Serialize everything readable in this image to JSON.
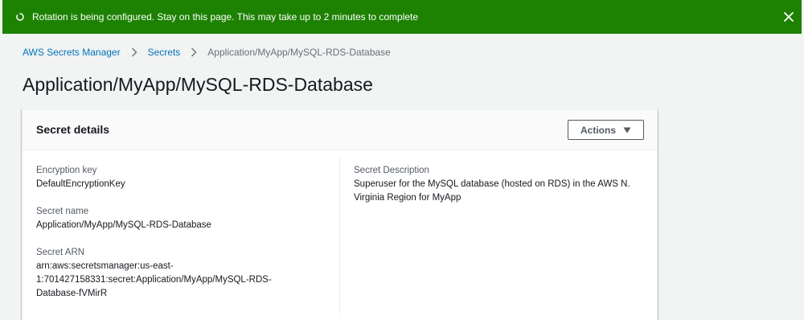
{
  "flash": {
    "message": "Rotation is being configured. Stay on this page. This may take up to 2 minutes to complete",
    "status": "in-progress",
    "color": "#1d8102",
    "icons": {
      "status": "spinner-icon",
      "dismiss": "close-icon"
    }
  },
  "breadcrumb": [
    {
      "label": "AWS Secrets Manager"
    },
    {
      "label": "Secrets"
    },
    {
      "label": "Application/MyApp/MySQL-RDS-Database"
    }
  ],
  "page_title": "Application/MyApp/MySQL-RDS-Database",
  "secret_details": {
    "title": "Secret details",
    "actions_label": "Actions",
    "left_column": {
      "encryption_key": {
        "label": "Encryption key",
        "value": "DefaultEncryptionKey"
      },
      "secret_name": {
        "label": "Secret name",
        "value": "Application/MyApp/MySQL-RDS-Database"
      },
      "secret_arn": {
        "label": "Secret ARN",
        "value_lines": [
          "arn:aws:secretsmanager:us-east-",
          "1:701427158331:secret:Application/MyApp/MySQL-RDS-",
          "Database-fVMirR"
        ]
      }
    },
    "right_column": {
      "description": {
        "label": "Secret Description",
        "value_lines": [
          "Superuser for the MySQL database (hosted on RDS) in the AWS N.",
          "Virginia Region for MyApp"
        ]
      }
    }
  },
  "colors": {
    "link": "#0073bb",
    "background": "#f2f3f3",
    "text": "#16191f",
    "secondary_text": "#545b64"
  }
}
